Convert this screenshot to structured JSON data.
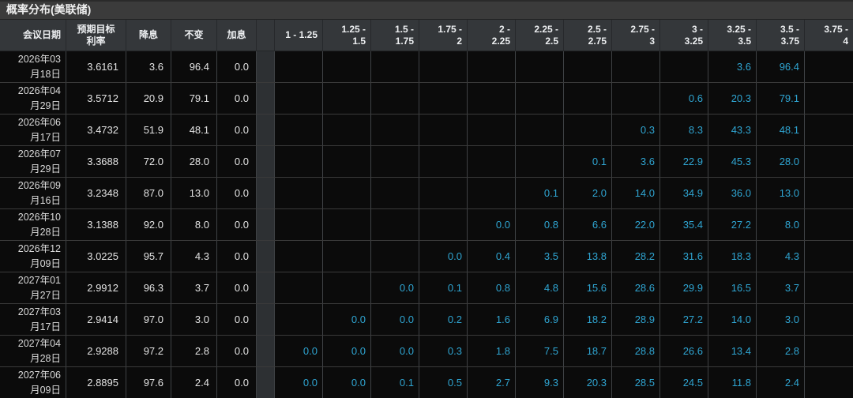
{
  "title": "概率分布(美联储)",
  "colors": {
    "accent_cyan": "#2fa5d2",
    "title_bg": "#3b3b3b",
    "header_bg": "#34373a",
    "body_bg": "#0b0b0b",
    "separator_bg": "#2d3033",
    "grid_line_body": "#3f4245",
    "grid_line_header": "#26282b",
    "text_light": "#e3e3e3"
  },
  "table": {
    "fixed_headers": {
      "meeting_date": "会议日期",
      "target_rate": "预期目标\n利率",
      "cut": "降息",
      "hold": "不变",
      "hike": "加息"
    },
    "rate_headers": [
      "1 - 1.25",
      "1.25 -\n1.5",
      "1.5 -\n1.75",
      "1.75 -\n2",
      "2 -\n2.25",
      "2.25 -\n2.5",
      "2.5 -\n2.75",
      "2.75 -\n3",
      "3 -\n3.25",
      "3.25 -\n3.5",
      "3.5 -\n3.75",
      "3.75 -\n4"
    ],
    "rows": [
      {
        "date": "2026年03\n月18日",
        "target": "3.6161",
        "cut": "3.6",
        "hold": "96.4",
        "hike": "0.0",
        "probs": [
          "",
          "",
          "",
          "",
          "",
          "",
          "",
          "",
          "",
          "3.6",
          "96.4",
          ""
        ]
      },
      {
        "date": "2026年04\n月29日",
        "target": "3.5712",
        "cut": "20.9",
        "hold": "79.1",
        "hike": "0.0",
        "probs": [
          "",
          "",
          "",
          "",
          "",
          "",
          "",
          "",
          "0.6",
          "20.3",
          "79.1",
          ""
        ]
      },
      {
        "date": "2026年06\n月17日",
        "target": "3.4732",
        "cut": "51.9",
        "hold": "48.1",
        "hike": "0.0",
        "probs": [
          "",
          "",
          "",
          "",
          "",
          "",
          "",
          "0.3",
          "8.3",
          "43.3",
          "48.1",
          ""
        ]
      },
      {
        "date": "2026年07\n月29日",
        "target": "3.3688",
        "cut": "72.0",
        "hold": "28.0",
        "hike": "0.0",
        "probs": [
          "",
          "",
          "",
          "",
          "",
          "",
          "0.1",
          "3.6",
          "22.9",
          "45.3",
          "28.0",
          ""
        ]
      },
      {
        "date": "2026年09\n月16日",
        "target": "3.2348",
        "cut": "87.0",
        "hold": "13.0",
        "hike": "0.0",
        "probs": [
          "",
          "",
          "",
          "",
          "",
          "0.1",
          "2.0",
          "14.0",
          "34.9",
          "36.0",
          "13.0",
          ""
        ]
      },
      {
        "date": "2026年10\n月28日",
        "target": "3.1388",
        "cut": "92.0",
        "hold": "8.0",
        "hike": "0.0",
        "probs": [
          "",
          "",
          "",
          "",
          "0.0",
          "0.8",
          "6.6",
          "22.0",
          "35.4",
          "27.2",
          "8.0",
          ""
        ]
      },
      {
        "date": "2026年12\n月09日",
        "target": "3.0225",
        "cut": "95.7",
        "hold": "4.3",
        "hike": "0.0",
        "probs": [
          "",
          "",
          "",
          "0.0",
          "0.4",
          "3.5",
          "13.8",
          "28.2",
          "31.6",
          "18.3",
          "4.3",
          ""
        ]
      },
      {
        "date": "2027年01\n月27日",
        "target": "2.9912",
        "cut": "96.3",
        "hold": "3.7",
        "hike": "0.0",
        "probs": [
          "",
          "",
          "0.0",
          "0.1",
          "0.8",
          "4.8",
          "15.6",
          "28.6",
          "29.9",
          "16.5",
          "3.7",
          ""
        ]
      },
      {
        "date": "2027年03\n月17日",
        "target": "2.9414",
        "cut": "97.0",
        "hold": "3.0",
        "hike": "0.0",
        "probs": [
          "",
          "0.0",
          "0.0",
          "0.2",
          "1.6",
          "6.9",
          "18.2",
          "28.9",
          "27.2",
          "14.0",
          "3.0",
          ""
        ]
      },
      {
        "date": "2027年04\n月28日",
        "target": "2.9288",
        "cut": "97.2",
        "hold": "2.8",
        "hike": "0.0",
        "probs": [
          "0.0",
          "0.0",
          "0.0",
          "0.3",
          "1.8",
          "7.5",
          "18.7",
          "28.8",
          "26.6",
          "13.4",
          "2.8",
          ""
        ]
      },
      {
        "date": "2027年06\n月09日",
        "target": "2.8895",
        "cut": "97.6",
        "hold": "2.4",
        "hike": "0.0",
        "probs": [
          "0.0",
          "0.0",
          "0.1",
          "0.5",
          "2.7",
          "9.3",
          "20.3",
          "28.5",
          "24.5",
          "11.8",
          "2.4",
          ""
        ]
      }
    ]
  }
}
